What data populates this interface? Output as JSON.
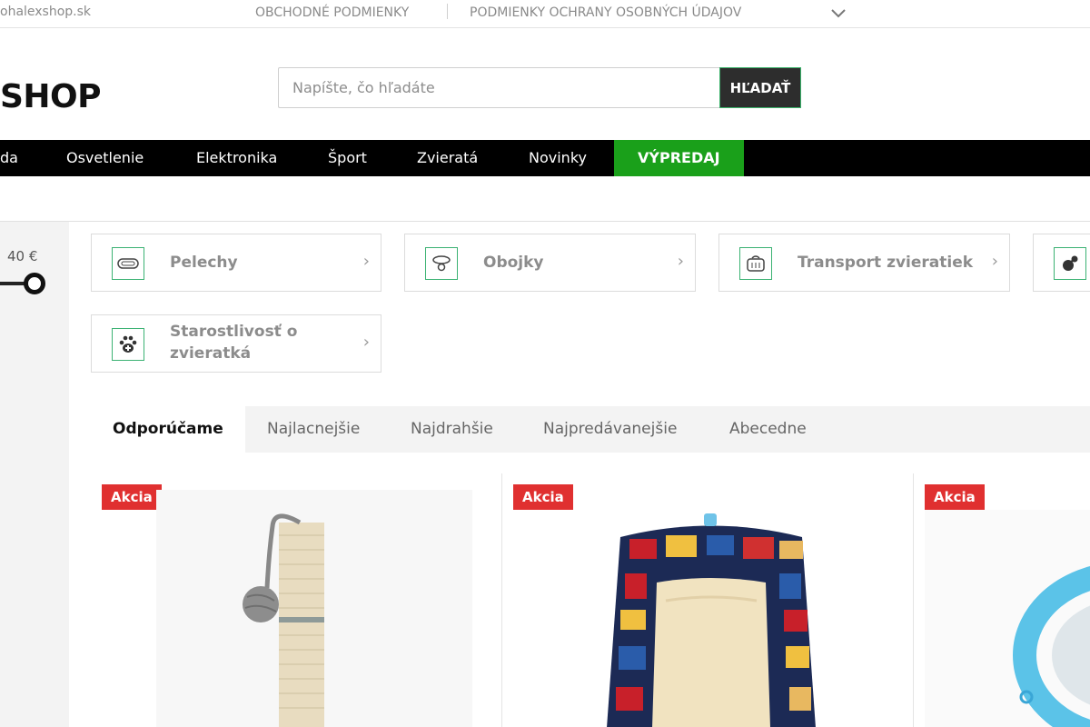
{
  "topbar": {
    "email": "ohalexshop.sk",
    "links": [
      "OBCHODNÉ PODMIENKY",
      "PODMIENKY OCHRANY OSOBNÝCH ÚDAJOV"
    ]
  },
  "header": {
    "logo": "SHOP",
    "search_placeholder": "Napíšte, čo hľadáte",
    "search_button": "HĽADAŤ"
  },
  "nav": {
    "items": [
      "da",
      "Osvetlenie",
      "Elektronika",
      "Šport",
      "Zvieratá",
      "Novinky"
    ],
    "sale": "VÝPREDAJ",
    "sale_color": "#1aa01a"
  },
  "filter": {
    "price_max": "40 €"
  },
  "categories": [
    {
      "label": "Pelechy",
      "icon": "pet-bed-icon"
    },
    {
      "label": "Obojky",
      "icon": "collar-icon"
    },
    {
      "label": "Transport zvieratiek",
      "icon": "pet-carrier-icon"
    },
    {
      "label": "",
      "icon": "toy-icon"
    },
    {
      "label_line1": "Starostlivosť o",
      "label_line2": "zvieratká",
      "icon": "paw-icon"
    }
  ],
  "tabs": [
    "Odporúčame",
    "Najlacnejšie",
    "Najdrahšie",
    "Najpredávanejšie",
    "Abecedne"
  ],
  "active_tab": "Odporúčame",
  "products": [
    {
      "badge": "Akcia"
    },
    {
      "badge": "Akcia"
    },
    {
      "badge": "Akcia"
    }
  ],
  "colors": {
    "accent_green": "#3bb273",
    "badge_red": "#e03030",
    "nav_bg": "#000000"
  }
}
